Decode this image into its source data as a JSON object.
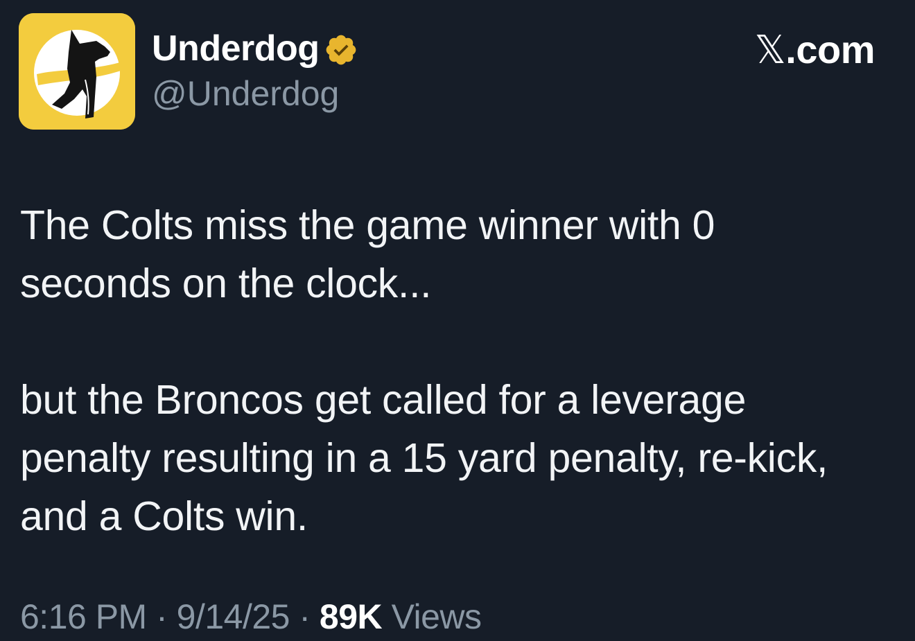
{
  "author": {
    "display_name": "Underdog",
    "handle": "@Underdog",
    "verified": true,
    "avatar_icon": "underdog-dog-logo-icon",
    "avatar_bg_color": "#f3cc3e",
    "verified_badge_color": "#e8b52e"
  },
  "brand": {
    "name": "X.com",
    "mark": "𝕏",
    "suffix": ".com"
  },
  "tweet": {
    "paragraph_1": "The Colts miss the game winner with 0 seconds on the clock...",
    "paragraph_2": "but the Broncos get called for a leverage penalty resulting in a 15 yard penalty, re-kick, and a Colts win."
  },
  "meta": {
    "time": "6:16 PM",
    "separator": " · ",
    "date": "9/14/25",
    "views_count": "89K",
    "views_label": "Views"
  },
  "colors": {
    "background": "#161d28",
    "text_primary": "#f2f4f6",
    "text_secondary": "#8b98a5"
  }
}
